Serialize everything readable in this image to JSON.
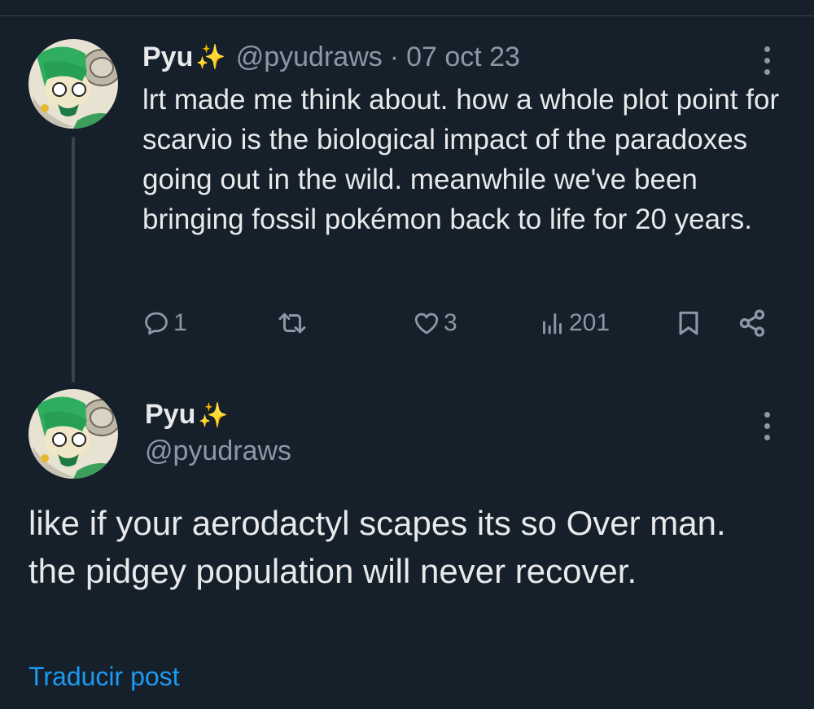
{
  "reply_tweet": {
    "author_name": "Pyu",
    "author_emoji": "✨",
    "handle": "@pyudraws",
    "separator": "·",
    "date": "07 oct 23",
    "text": "lrt made me think about. how a whole plot point for scarvio is the biological impact of the paradoxes going out in the wild. meanwhile we've been bringing fossil pokémon back to life for 20 years.",
    "actions": {
      "replies": "1",
      "retweets": "",
      "likes": "3",
      "views": "201"
    }
  },
  "main_tweet": {
    "author_name": "Pyu",
    "author_emoji": "✨",
    "handle": "@pyudraws",
    "text": "like if your aerodactyl scapes its so Over man. the pidgey population will never recover.",
    "translate_label": "Traducir post"
  },
  "icons": {
    "reply": "speech-bubble-icon",
    "retweet": "retweet-arrows-icon",
    "like": "heart-icon",
    "views": "bar-chart-icon",
    "bookmark": "bookmark-icon",
    "share": "share-nodes-icon",
    "more": "three-dots-vertical-icon",
    "sparkle": "sparkles-emoji"
  },
  "colors": {
    "background": "#15202b",
    "primary_text": "#e7e9ea",
    "secondary_text": "#8b98a5",
    "link": "#1d9bf0",
    "divider": "#38444d"
  }
}
